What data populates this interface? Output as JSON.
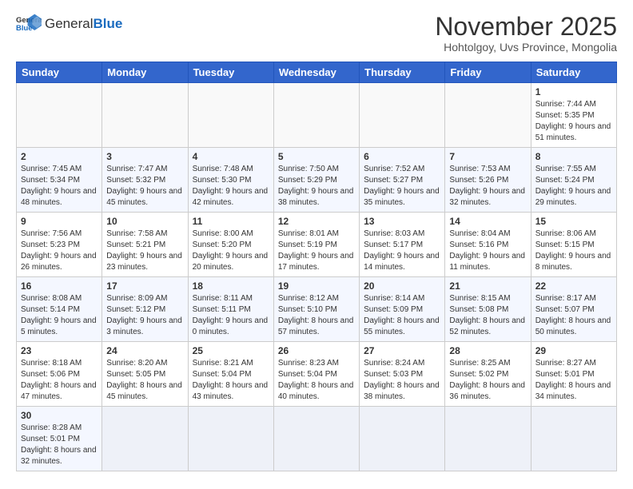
{
  "header": {
    "logo_general": "General",
    "logo_blue": "Blue",
    "month_title": "November 2025",
    "location": "Hohtolgoy, Uvs Province, Mongolia"
  },
  "weekdays": [
    "Sunday",
    "Monday",
    "Tuesday",
    "Wednesday",
    "Thursday",
    "Friday",
    "Saturday"
  ],
  "weeks": [
    [
      {
        "day": "",
        "info": ""
      },
      {
        "day": "",
        "info": ""
      },
      {
        "day": "",
        "info": ""
      },
      {
        "day": "",
        "info": ""
      },
      {
        "day": "",
        "info": ""
      },
      {
        "day": "",
        "info": ""
      },
      {
        "day": "1",
        "info": "Sunrise: 7:44 AM\nSunset: 5:35 PM\nDaylight: 9 hours and 51 minutes."
      }
    ],
    [
      {
        "day": "2",
        "info": "Sunrise: 7:45 AM\nSunset: 5:34 PM\nDaylight: 9 hours and 48 minutes."
      },
      {
        "day": "3",
        "info": "Sunrise: 7:47 AM\nSunset: 5:32 PM\nDaylight: 9 hours and 45 minutes."
      },
      {
        "day": "4",
        "info": "Sunrise: 7:48 AM\nSunset: 5:30 PM\nDaylight: 9 hours and 42 minutes."
      },
      {
        "day": "5",
        "info": "Sunrise: 7:50 AM\nSunset: 5:29 PM\nDaylight: 9 hours and 38 minutes."
      },
      {
        "day": "6",
        "info": "Sunrise: 7:52 AM\nSunset: 5:27 PM\nDaylight: 9 hours and 35 minutes."
      },
      {
        "day": "7",
        "info": "Sunrise: 7:53 AM\nSunset: 5:26 PM\nDaylight: 9 hours and 32 minutes."
      },
      {
        "day": "8",
        "info": "Sunrise: 7:55 AM\nSunset: 5:24 PM\nDaylight: 9 hours and 29 minutes."
      }
    ],
    [
      {
        "day": "9",
        "info": "Sunrise: 7:56 AM\nSunset: 5:23 PM\nDaylight: 9 hours and 26 minutes."
      },
      {
        "day": "10",
        "info": "Sunrise: 7:58 AM\nSunset: 5:21 PM\nDaylight: 9 hours and 23 minutes."
      },
      {
        "day": "11",
        "info": "Sunrise: 8:00 AM\nSunset: 5:20 PM\nDaylight: 9 hours and 20 minutes."
      },
      {
        "day": "12",
        "info": "Sunrise: 8:01 AM\nSunset: 5:19 PM\nDaylight: 9 hours and 17 minutes."
      },
      {
        "day": "13",
        "info": "Sunrise: 8:03 AM\nSunset: 5:17 PM\nDaylight: 9 hours and 14 minutes."
      },
      {
        "day": "14",
        "info": "Sunrise: 8:04 AM\nSunset: 5:16 PM\nDaylight: 9 hours and 11 minutes."
      },
      {
        "day": "15",
        "info": "Sunrise: 8:06 AM\nSunset: 5:15 PM\nDaylight: 9 hours and 8 minutes."
      }
    ],
    [
      {
        "day": "16",
        "info": "Sunrise: 8:08 AM\nSunset: 5:14 PM\nDaylight: 9 hours and 5 minutes."
      },
      {
        "day": "17",
        "info": "Sunrise: 8:09 AM\nSunset: 5:12 PM\nDaylight: 9 hours and 3 minutes."
      },
      {
        "day": "18",
        "info": "Sunrise: 8:11 AM\nSunset: 5:11 PM\nDaylight: 9 hours and 0 minutes."
      },
      {
        "day": "19",
        "info": "Sunrise: 8:12 AM\nSunset: 5:10 PM\nDaylight: 8 hours and 57 minutes."
      },
      {
        "day": "20",
        "info": "Sunrise: 8:14 AM\nSunset: 5:09 PM\nDaylight: 8 hours and 55 minutes."
      },
      {
        "day": "21",
        "info": "Sunrise: 8:15 AM\nSunset: 5:08 PM\nDaylight: 8 hours and 52 minutes."
      },
      {
        "day": "22",
        "info": "Sunrise: 8:17 AM\nSunset: 5:07 PM\nDaylight: 8 hours and 50 minutes."
      }
    ],
    [
      {
        "day": "23",
        "info": "Sunrise: 8:18 AM\nSunset: 5:06 PM\nDaylight: 8 hours and 47 minutes."
      },
      {
        "day": "24",
        "info": "Sunrise: 8:20 AM\nSunset: 5:05 PM\nDaylight: 8 hours and 45 minutes."
      },
      {
        "day": "25",
        "info": "Sunrise: 8:21 AM\nSunset: 5:04 PM\nDaylight: 8 hours and 43 minutes."
      },
      {
        "day": "26",
        "info": "Sunrise: 8:23 AM\nSunset: 5:04 PM\nDaylight: 8 hours and 40 minutes."
      },
      {
        "day": "27",
        "info": "Sunrise: 8:24 AM\nSunset: 5:03 PM\nDaylight: 8 hours and 38 minutes."
      },
      {
        "day": "28",
        "info": "Sunrise: 8:25 AM\nSunset: 5:02 PM\nDaylight: 8 hours and 36 minutes."
      },
      {
        "day": "29",
        "info": "Sunrise: 8:27 AM\nSunset: 5:01 PM\nDaylight: 8 hours and 34 minutes."
      }
    ],
    [
      {
        "day": "30",
        "info": "Sunrise: 8:28 AM\nSunset: 5:01 PM\nDaylight: 8 hours and 32 minutes."
      },
      {
        "day": "",
        "info": ""
      },
      {
        "day": "",
        "info": ""
      },
      {
        "day": "",
        "info": ""
      },
      {
        "day": "",
        "info": ""
      },
      {
        "day": "",
        "info": ""
      },
      {
        "day": "",
        "info": ""
      }
    ]
  ]
}
